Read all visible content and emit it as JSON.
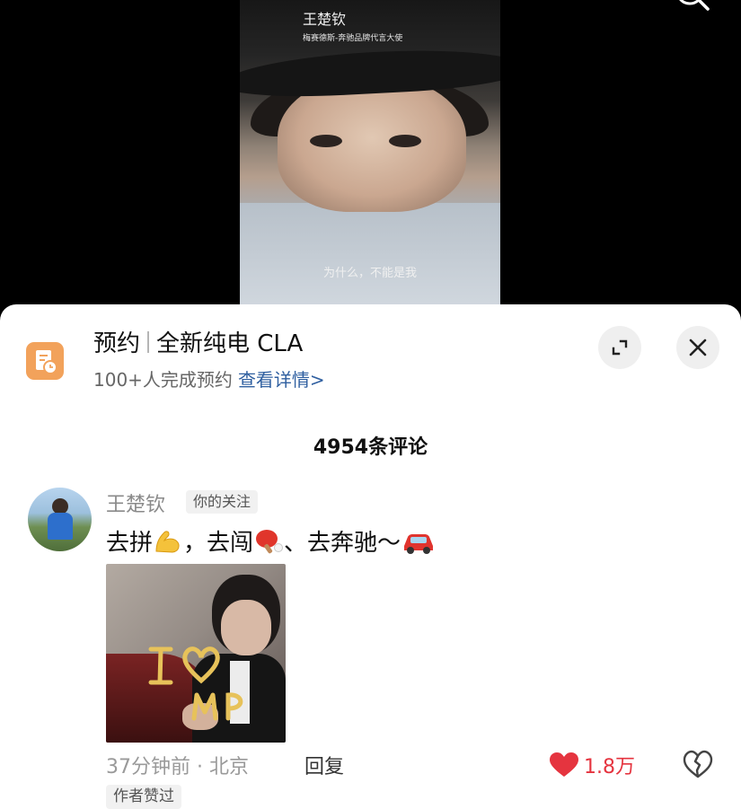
{
  "video": {
    "title": "王楚钦",
    "subtitle": "梅赛德斯-奔驰品牌代言大使",
    "caption": "为什么，不能是我"
  },
  "reservation": {
    "label": "预约",
    "product": "全新纯电 CLA",
    "stats": "100+人完成预约",
    "link": "查看详情>"
  },
  "comments_header": {
    "count_text": "4954条评论"
  },
  "comment": {
    "username": "王楚钦",
    "follow_tag": "你的关注",
    "text_parts": [
      "去拼",
      "，去闯",
      "、去奔驰～"
    ],
    "emojis": [
      "flexed-biceps-icon",
      "ping-pong-icon",
      "red-car-icon"
    ],
    "meta": "37分钟前 · 北京",
    "reply_label": "回复",
    "like_count": "1.8万",
    "author_tag": "作者赞过"
  },
  "colors": {
    "like": "#e5343f",
    "link": "#2f5fa0",
    "reserve_icon": "#f2a25b"
  }
}
